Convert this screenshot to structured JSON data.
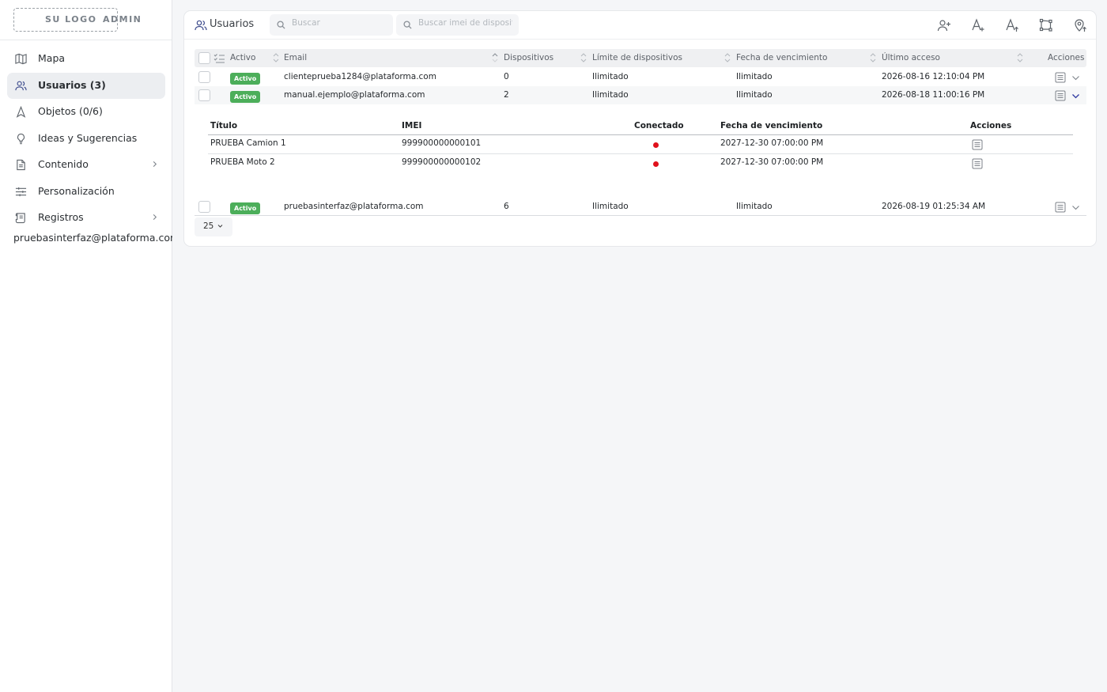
{
  "brand": {
    "logo_text": "SU LOGO",
    "admin_text": "ADMIN"
  },
  "sidebar": {
    "items": [
      {
        "label": "Mapa",
        "icon": "map-icon",
        "active": false,
        "has_chevron": false
      },
      {
        "label": "Usuarios (3)",
        "icon": "users-icon",
        "active": true,
        "has_chevron": false
      },
      {
        "label": "Objetos (0/6)",
        "icon": "navigation-arrow-icon",
        "active": false,
        "has_chevron": false
      },
      {
        "label": "Ideas y Sugerencias",
        "icon": "lightbulb-icon",
        "active": false,
        "has_chevron": false
      },
      {
        "label": "Contenido",
        "icon": "document-icon",
        "active": false,
        "has_chevron": true
      },
      {
        "label": "Personalización",
        "icon": "sliders-icon",
        "active": false,
        "has_chevron": false
      },
      {
        "label": "Registros",
        "icon": "scroll-icon",
        "active": false,
        "has_chevron": true
      }
    ],
    "user_email": "pruebasinterfaz@plataforma.com (D"
  },
  "header": {
    "title": "Usuarios",
    "search_placeholder": "Buscar",
    "imei_search_placeholder": "Buscar imei de dispositivo",
    "toolbar_icons": [
      "add-user-icon",
      "add-text-icon",
      "upload-text-icon",
      "draw-polygon-icon",
      "upload-location-icon"
    ]
  },
  "table": {
    "columns": {
      "activo": "Activo",
      "email": "Email",
      "dispositivos": "Dispositivos",
      "limite": "Límite de dispositivos",
      "vencimiento": "Fecha de vencimiento",
      "ultimo_acceso": "Último acceso",
      "acciones": "Acciones"
    },
    "rows": [
      {
        "status": "Activo",
        "email": "clienteprueba1284@plataforma.com",
        "dispositivos": "0",
        "limite": "Ilimitado",
        "vencimiento": "Ilimitado",
        "ultimo_acceso": "2026-08-16 12:10:04 PM"
      },
      {
        "status": "Activo",
        "email": "manual.ejemplo@plataforma.com",
        "dispositivos": "2",
        "limite": "Ilimitado",
        "vencimiento": "Ilimitado",
        "ultimo_acceso": "2026-08-18 11:00:16 PM"
      },
      {
        "status": "Activo",
        "email": "pruebasinterfaz@plataforma.com",
        "dispositivos": "6",
        "limite": "Ilimitado",
        "vencimiento": "Ilimitado",
        "ultimo_acceso": "2026-08-19 01:25:34 AM"
      }
    ]
  },
  "devices": {
    "columns": {
      "titulo": "Título",
      "imei": "IMEI",
      "conectado": "Conectado",
      "vencimiento": "Fecha de vencimiento",
      "acciones": "Acciones"
    },
    "rows": [
      {
        "titulo": "PRUEBA Camion 1",
        "imei": "999900000000101",
        "conectado": "disconnected",
        "vencimiento": "2027-12-30 07:00:00 PM"
      },
      {
        "titulo": "PRUEBA Moto 2",
        "imei": "999900000000102",
        "conectado": "disconnected",
        "vencimiento": "2027-12-30 07:00:00 PM"
      }
    ]
  },
  "pagination": {
    "page_size": "25"
  },
  "colors": {
    "accent": "#4cae5a",
    "status_offline": "#e0111c",
    "sidebar_active": "#eceef1"
  }
}
